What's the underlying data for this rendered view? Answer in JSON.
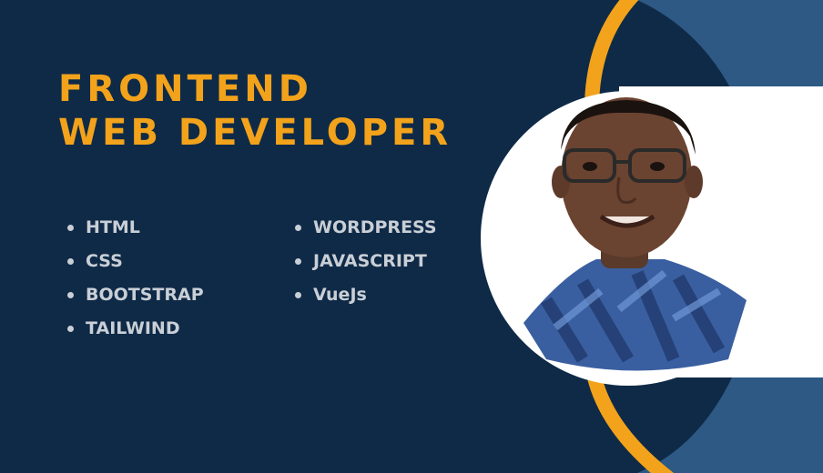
{
  "title": {
    "line1": "FRONTEND",
    "line2": "WEB DEVELOPER"
  },
  "skills": {
    "column1": [
      "HTML",
      "CSS",
      "BOOTSTRAP",
      "TAILWIND"
    ],
    "column2": [
      "WORDPRESS",
      "JAVASCRIPT",
      "VueJs"
    ]
  },
  "colors": {
    "background": "#0f2a47",
    "accent": "#f2a31b",
    "panel": "#2d5984",
    "text": "#c9cfd6"
  },
  "photo": {
    "description_icon": "person-portrait"
  }
}
